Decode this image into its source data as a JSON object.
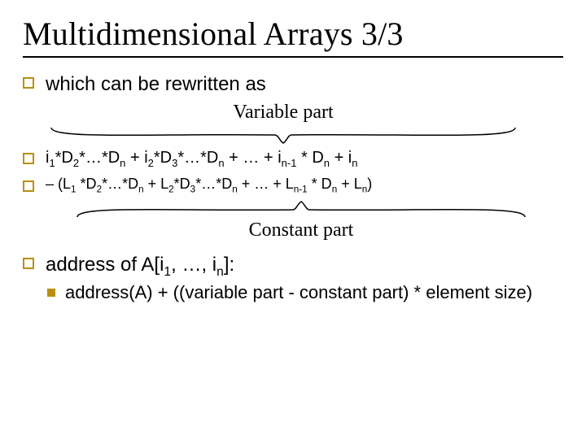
{
  "title": "Multidimensional Arrays 3/3",
  "bullets": {
    "b1": "which can be rewritten as",
    "b4": "address of A[i",
    "b4_tail": "]:",
    "b5": "address(A) + ((variable part - constant part) * element size)"
  },
  "labels": {
    "variable": "Variable part",
    "constant": "Constant part"
  },
  "formula1": {
    "p1": "i",
    "s1": "1",
    "p2": "*D",
    "s2": "2",
    "p3": "*…*D",
    "s3": "n",
    "p4": " + i",
    "s4": "2",
    "p5": "*D",
    "s5": "3",
    "p6": "*…*D",
    "s6": "n",
    "p7": " +  … + i",
    "s7": "n-1",
    "p8": " * D",
    "s8": "n",
    "p9": " + i",
    "s9": "n"
  },
  "formula2": {
    "lead": "–   (L",
    "s1": "1",
    "p2": " *D",
    "s2": "2",
    "p3": "*…*D",
    "s3": "n",
    "p4": " + L",
    "s4": "2",
    "p5": "*D",
    "s5": "3",
    "p6": "*…*D",
    "s6": "n",
    "p7": " +  … + L",
    "s7": "n-1",
    "p8": " * D",
    "s8": "n",
    "p9": " + L",
    "s9": "n",
    "tail": ")"
  },
  "idx": {
    "one": "1",
    "dots": ", …, i",
    "n": "n"
  }
}
